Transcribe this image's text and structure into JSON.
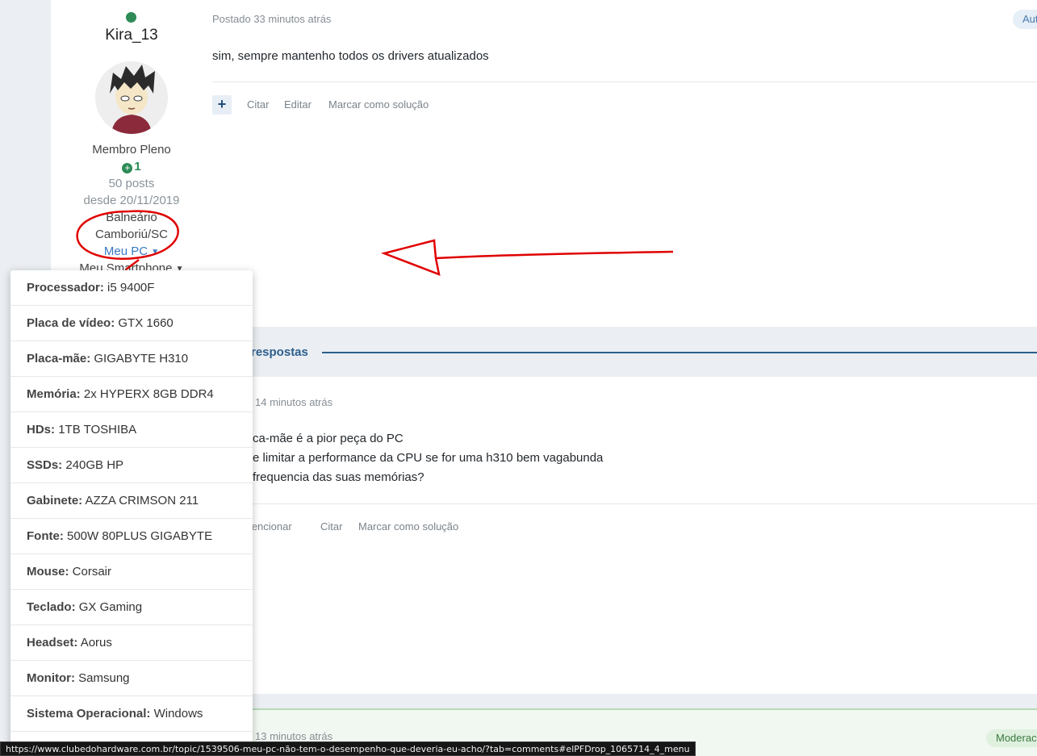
{
  "post1": {
    "author": "Kira_13",
    "rank": "Membro Pleno",
    "reputation": "1",
    "posts": "50 posts",
    "since": "desde 20/11/2019",
    "location_line1": "Balneário",
    "location_line2": "Camboriú/SC",
    "meu_pc": "Meu PC",
    "meu_smartphone": "Meu Smartphone",
    "posted": "Postado 33 minutos atrás",
    "badge": "Aut",
    "content": "sim, sempre mantenho todos os drivers atualizados",
    "actions": {
      "quote": "Citar",
      "edit": "Editar",
      "solution": "Marcar como solução"
    }
  },
  "replies_bar": {
    "title": "respostas"
  },
  "post2": {
    "posted": "14 minutos atrás",
    "lines": [
      "ca-mãe é a pior peça do PC",
      "e limitar a performance da CPU se for uma h310 bem vagabunda",
      "frequencia das suas memórias?"
    ],
    "actions": {
      "mention": "mencionar",
      "quote": "Citar",
      "solution": "Marcar como solução"
    }
  },
  "post3": {
    "posted": "13 minutos atrás",
    "badge": "Moderac"
  },
  "pc_dropdown": {
    "items": [
      {
        "key": "Processador:",
        "value": "i5 9400F"
      },
      {
        "key": "Placa de vídeo:",
        "value": "GTX 1660"
      },
      {
        "key": "Placa-mãe:",
        "value": "GIGABYTE H310"
      },
      {
        "key": "Memória:",
        "value": "2x HYPERX 8GB DDR4"
      },
      {
        "key": "HDs:",
        "value": "1TB TOSHIBA"
      },
      {
        "key": "SSDs:",
        "value": "240GB HP"
      },
      {
        "key": "Gabinete:",
        "value": "AZZA CRIMSON 211"
      },
      {
        "key": "Fonte:",
        "value": "500W 80PLUS GIGABYTE"
      },
      {
        "key": "Mouse:",
        "value": "Corsair"
      },
      {
        "key": "Teclado:",
        "value": "GX Gaming"
      },
      {
        "key": "Headset:",
        "value": "Aorus"
      },
      {
        "key": "Monitor:",
        "value": "Samsung"
      },
      {
        "key": "Sistema Operacional:",
        "value": "Windows"
      }
    ]
  },
  "status_url": "https://www.clubedohardware.com.br/topic/1539506-meu-pc-não-tem-o-desempenho-que-deveria-eu-acho/?tab=comments#elPFDrop_1065714_4_menu",
  "colors": {
    "annotation": "#e00000",
    "link": "#3a7bbf",
    "online": "#2e8b57"
  }
}
